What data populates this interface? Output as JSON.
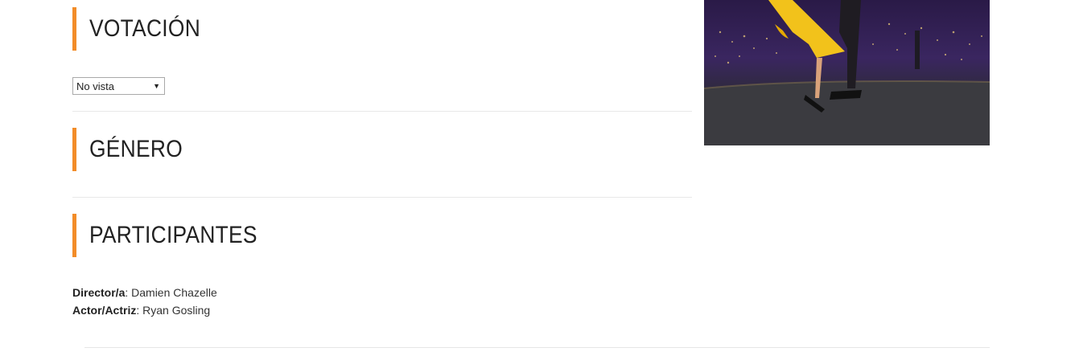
{
  "sections": {
    "votacion": {
      "title": "VOTACIÓN"
    },
    "genero": {
      "title": "GÉNERO"
    },
    "participantes": {
      "title": "PARTICIPANTES"
    }
  },
  "vote_select": {
    "selected": "No vista"
  },
  "credits": [
    {
      "role": "Director/a",
      "name": "Damien Chazelle"
    },
    {
      "role": "Actor/Actriz",
      "name": "Ryan Gosling"
    }
  ],
  "colors": {
    "accent": "#f28c28",
    "divider": "#e8e8e8",
    "text": "#222222"
  },
  "poster": {
    "description_icon": "movie-poster-image"
  }
}
